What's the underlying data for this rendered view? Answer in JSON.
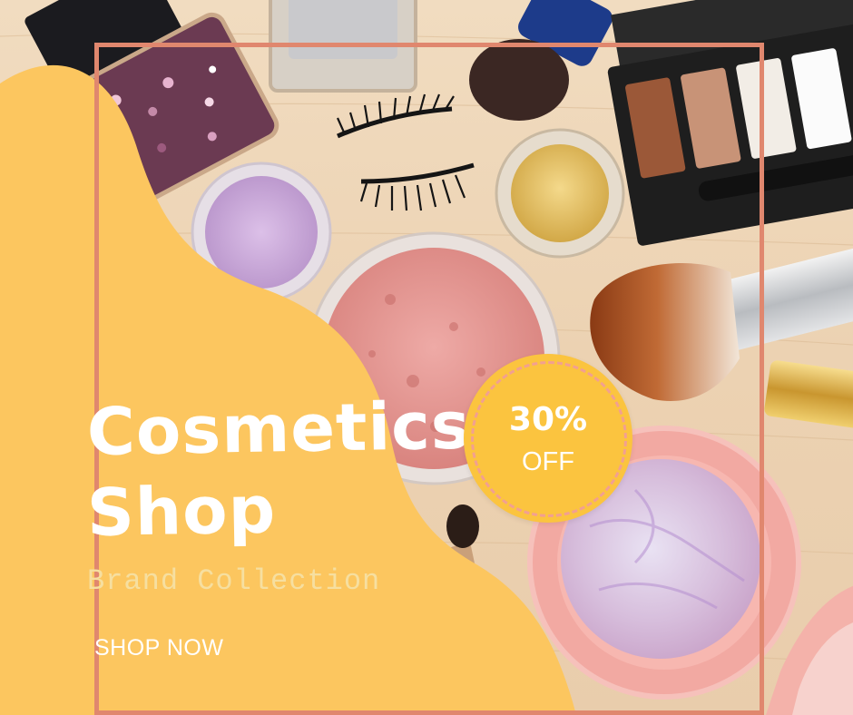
{
  "title_line1": "Cosmetics",
  "title_line2": "Shop",
  "subtitle": "Brand Collection",
  "cta": "SHOP NOW",
  "badge": {
    "percent": "30%",
    "off": "OFF"
  },
  "colors": {
    "blob": "#fcc65f",
    "frame": "#e0876e",
    "badge": "#fbc43f",
    "subtitle": "#f6dfa0",
    "text": "#ffffff"
  }
}
